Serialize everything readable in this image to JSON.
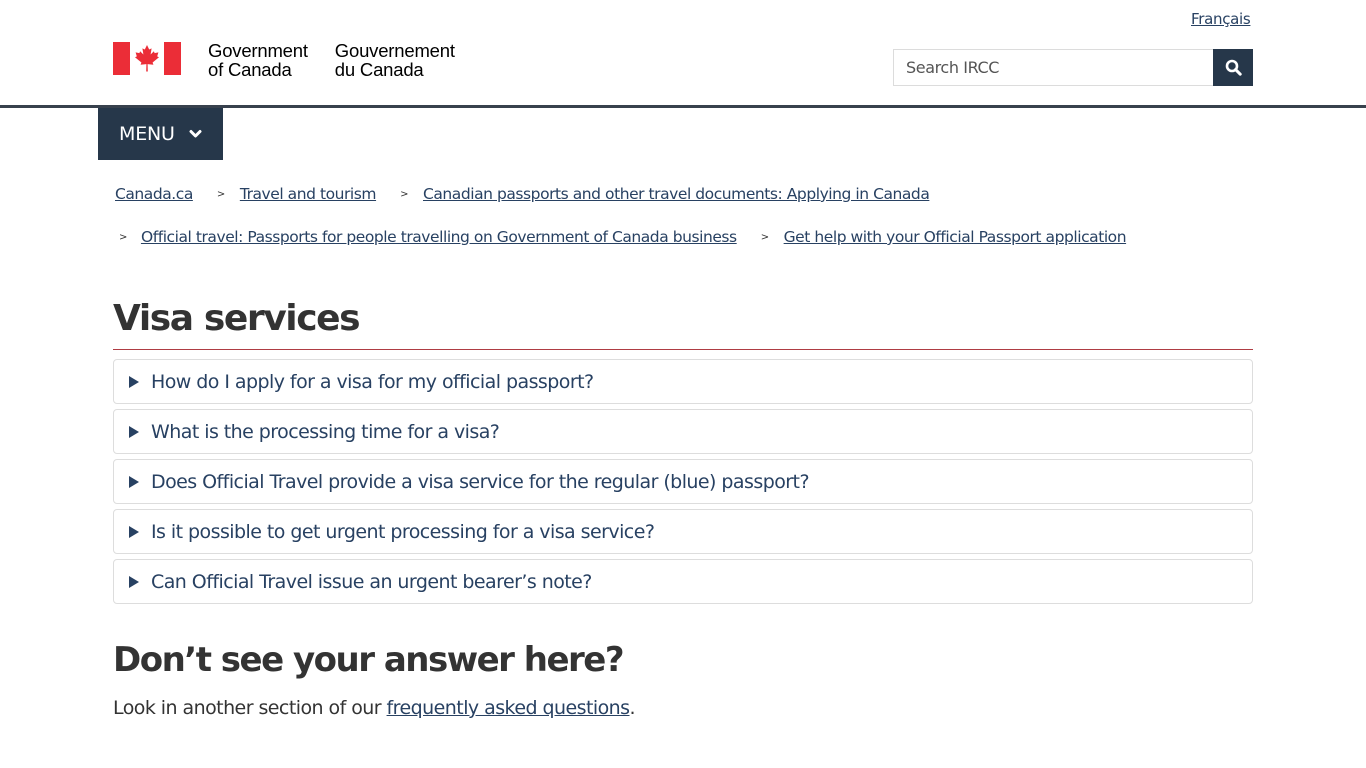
{
  "header": {
    "language_link": "Français",
    "wordmark_en": [
      "Government",
      "of Canada"
    ],
    "wordmark_fr": [
      "Gouvernement",
      "du Canada"
    ],
    "search": {
      "placeholder": "Search IRCC",
      "value": "",
      "button_icon": "search-icon"
    },
    "menu_label": "MENU",
    "menu_icon": "chevron-down-icon"
  },
  "breadcrumb": [
    {
      "label": "Canada.ca"
    },
    {
      "label": "Travel and tourism"
    },
    {
      "label": "Canadian passports and other travel documents: Applying in Canada"
    },
    {
      "label": "Official travel: Passports for people travelling on Government of Canada business"
    },
    {
      "label": "Get help with your Official Passport application"
    }
  ],
  "breadcrumb_separator": ">",
  "main": {
    "title": "Visa services",
    "faqs": [
      {
        "question": "How do I apply for a visa for my official passport?"
      },
      {
        "question": "What is the processing time for a visa?"
      },
      {
        "question": "Does Official Travel provide a visa service for the regular (blue) passport?"
      },
      {
        "question": "Is it possible to get urgent processing for a visa service?"
      },
      {
        "question": "Can Official Travel issue an urgent bearer’s note?"
      }
    ],
    "subheading": "Don’t see your answer here?",
    "paragraph_before": "Look in another section of our ",
    "paragraph_link": "frequently asked questions",
    "paragraph_after": "."
  },
  "colors": {
    "primary_dark": "#26374a",
    "link": "#284162",
    "title_rule": "#af3c43",
    "flag_red": "#eb2d37"
  }
}
